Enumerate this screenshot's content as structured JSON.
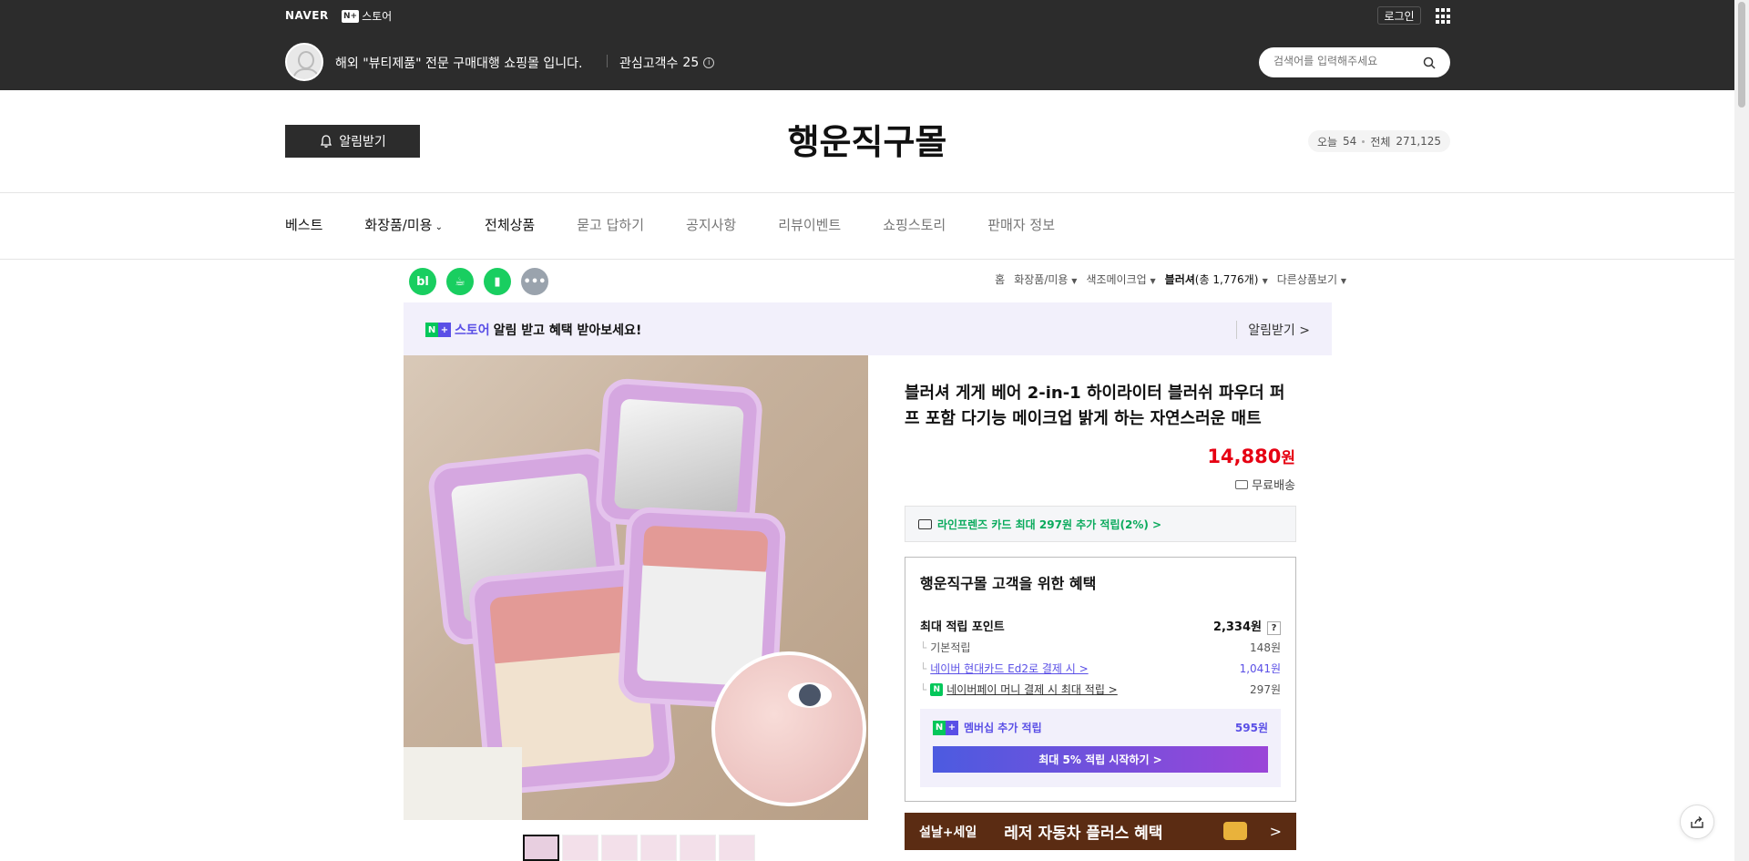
{
  "topbar": {
    "brand": "NAVER",
    "store_badge": "N+",
    "store_label": "스토어",
    "login": "로그인",
    "store_desc": "해외 \"뷰티제품\" 전문 구매대행 쇼핑몰 입니다.",
    "interest_label": "관심고객수",
    "interest_count": "25",
    "search_placeholder": "검색어를 입력해주세요"
  },
  "header": {
    "alarm_button": "알림받기",
    "store_title": "행운직구몰",
    "visit_today_label": "오늘",
    "visit_today": "54",
    "visit_total_label": "전체",
    "visit_total": "271,125"
  },
  "nav": {
    "items": [
      "베스트",
      "화장품/미용",
      "전체상품",
      "묻고 답하기",
      "공지사항",
      "리뷰이벤트",
      "쇼핑스토리",
      "판매자 정보"
    ]
  },
  "share_icons": [
    "blog-icon",
    "cafe-icon",
    "bookmark-icon",
    "more-icon"
  ],
  "breadcrumb": {
    "home": "홈",
    "cat1": "화장품/미용",
    "cat2": "색조메이크업",
    "cat3": "블러셔",
    "count": "(총 1,776개)",
    "other": "다른상품보기"
  },
  "notify_banner": {
    "badge": "N+",
    "store_word": "스토어",
    "text": "알림 받고 혜택 받아보세요!",
    "action": "알림받기 >"
  },
  "product": {
    "title": "블러셔 게게 베어 2-in-1 하이라이터 블러쉬 파우더 퍼프 포함 다기능 메이크업 밝게 하는 자연스러운 매트",
    "price": "14,880",
    "currency": "원",
    "shipping": "무료배송",
    "card_offer": "라인프렌즈 카드 최대 297원 추가 적립(2%) >",
    "thumbnail_count": 6
  },
  "benefit": {
    "title": "행운직구몰 고객을 위한 혜택",
    "max_label": "최대 적립 포인트",
    "max_value": "2,334원",
    "rows": [
      {
        "label": "기본적립",
        "value": "148원"
      },
      {
        "label": "네이버 현대카드 Ed2로 결제 시 >",
        "value": "1,041원"
      },
      {
        "label": "네이버페이 머니 결제 시 최대 적립 >",
        "value": "297원"
      }
    ],
    "member_label": "멤버십 추가 적립",
    "member_value": "595원",
    "member_button": "최대 5% 적립 시작하기 >"
  },
  "promo": {
    "tag": "설날+세일",
    "text": "레저 자동차 플러스 혜택",
    "arrow": ">"
  }
}
